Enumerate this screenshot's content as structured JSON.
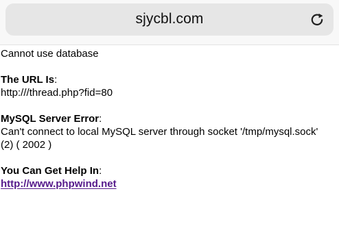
{
  "browser": {
    "address": "sjycbl.com",
    "reload_icon": "reload-icon"
  },
  "page": {
    "message": "Cannot use database",
    "url_label": "The URL Is",
    "url_colon": ":",
    "url_value": "http:///thread.php?fid=80",
    "error_label": "MySQL Server Error",
    "error_colon": ":",
    "error_line_1": "Can't connect to local MySQL server through socket '/tmp/mysql.sock'",
    "error_line_2": "(2) ( 2002 )",
    "help_label": "You Can Get Help In",
    "help_colon": ":",
    "help_link": "http://www.phpwind.net"
  },
  "colors": {
    "link": "#551a8b",
    "chrome_background": "#f8f8f8",
    "address_background": "#e6e6e6"
  }
}
